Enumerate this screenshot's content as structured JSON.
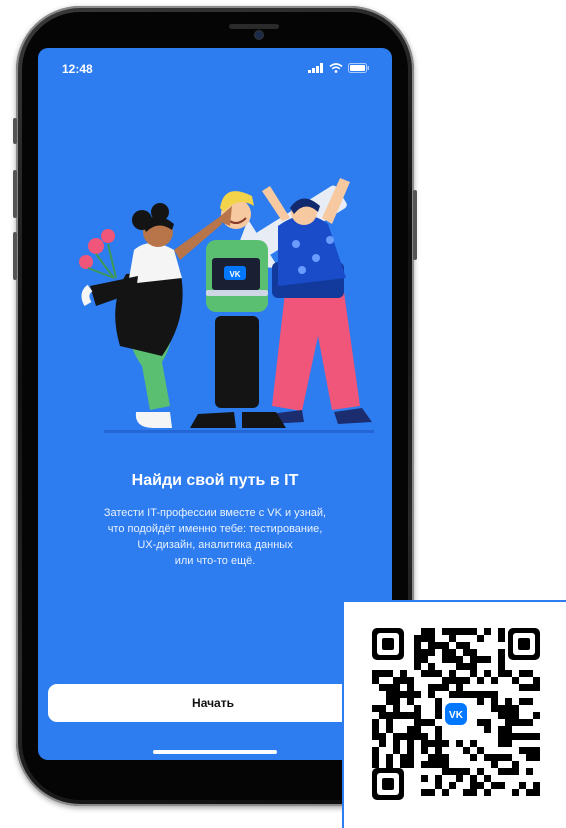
{
  "status_bar": {
    "time": "12:48",
    "icons": [
      "signal-icon",
      "wifi-icon",
      "battery-icon"
    ]
  },
  "onboarding": {
    "title": "Найди свой путь в IT",
    "description": "Затести IT-профессии вместе с VK и узнай,\nчто подойдёт именно тебе: тестирование,\nUX-дизайн, аналитика данных\nили что-то ещё.",
    "start_button": "Начать",
    "laptop_logo": "VK"
  },
  "qr_code": {
    "center_logo": "VK"
  },
  "colors": {
    "screen_background": "#2d7cf0",
    "button_background": "#ffffff",
    "vk_blue": "#0077ff"
  }
}
